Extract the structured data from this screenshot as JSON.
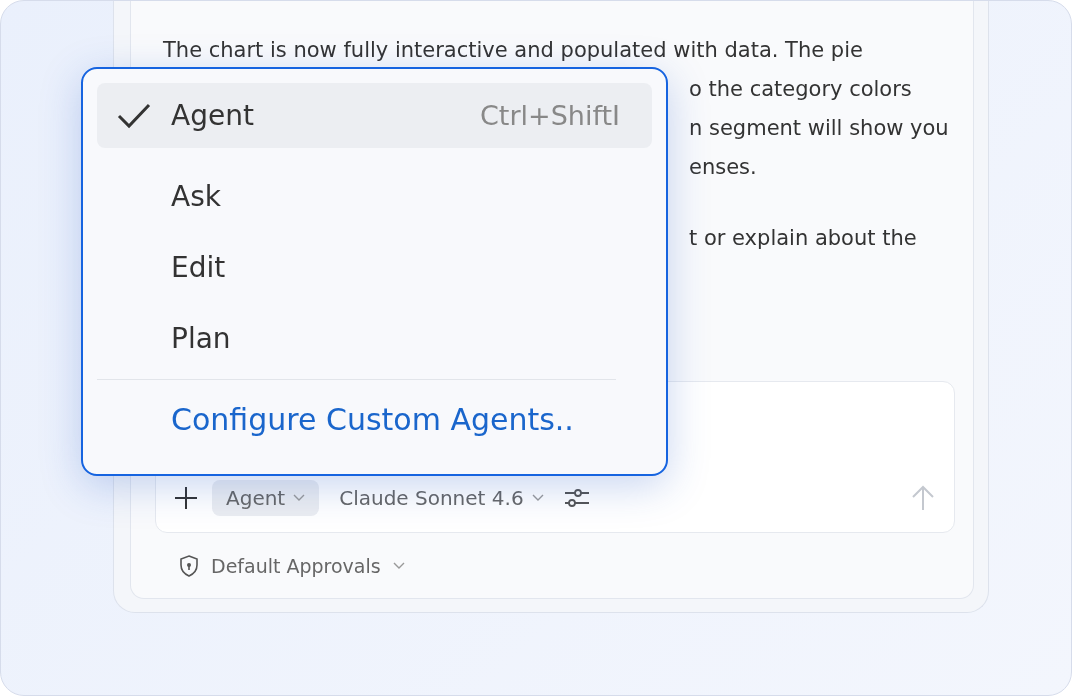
{
  "message": {
    "paragraphs": [
      {
        "lines": [
          {
            "kind": "full",
            "text": "The chart is now fully interactive and populated with data. The pie"
          },
          {
            "kind": "partial",
            "text": "o the category colors"
          },
          {
            "kind": "partial",
            "text": "n segment will show you"
          },
          {
            "kind": "partial",
            "text": "enses."
          }
        ]
      },
      {
        "lines": [
          {
            "kind": "partial",
            "text": "t or explain about the"
          }
        ]
      }
    ]
  },
  "mode_menu": {
    "items": [
      {
        "label": "Agent",
        "shortcut": "Ctrl+ShiftI",
        "selected": true
      },
      {
        "label": "Ask",
        "selected": false
      },
      {
        "label": "Edit",
        "selected": false
      },
      {
        "label": "Plan",
        "selected": false
      }
    ],
    "link": "Configure Custom Agents.."
  },
  "composer": {
    "mode": "Agent",
    "model": "Claude Sonnet 4.6"
  },
  "approvals": "Default Approvals"
}
